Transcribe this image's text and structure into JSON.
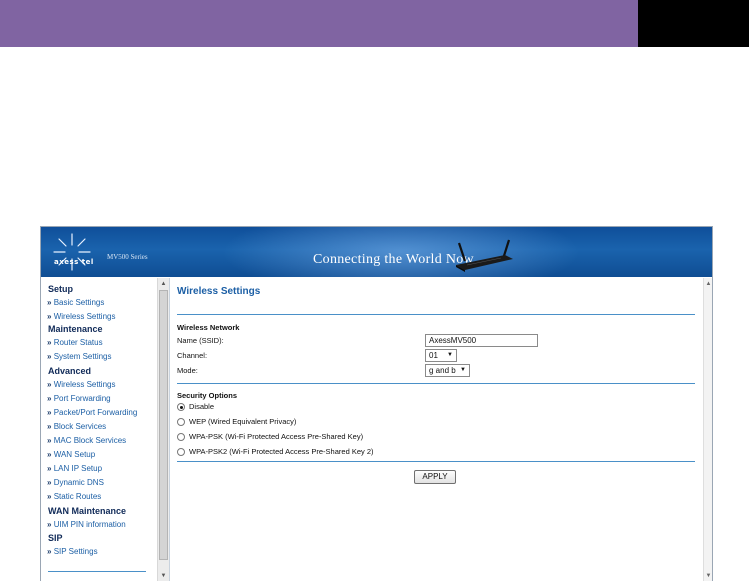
{
  "banner": {
    "logo_text": "axess tel",
    "series": "MV500 Series",
    "tagline": "Connecting the World Now"
  },
  "sidebar": {
    "arrow": "»",
    "sections": [
      {
        "heading": "Setup",
        "items": [
          "Basic Settings",
          "Wireless Settings"
        ]
      },
      {
        "heading": "Maintenance",
        "items": [
          "Router Status",
          "System Settings"
        ]
      },
      {
        "heading": "Advanced",
        "items": [
          "Wireless Settings",
          "Port Forwarding",
          "Packet/Port Forwarding",
          "Block Services",
          "MAC Block Services",
          "WAN Setup",
          "LAN IP Setup",
          "Dynamic DNS",
          "Static Routes"
        ]
      },
      {
        "heading": "WAN Maintenance",
        "items": [
          "UIM PIN information"
        ]
      },
      {
        "heading": "SIP",
        "items": [
          "SIP Settings"
        ]
      }
    ]
  },
  "main": {
    "title": "Wireless Settings",
    "wireless_network": {
      "heading": "Wireless Network",
      "ssid_label": "Name (SSID):",
      "ssid_value": "AxessMV500",
      "channel_label": "Channel:",
      "channel_value": "01",
      "mode_label": "Mode:",
      "mode_value": "g and b"
    },
    "security": {
      "heading": "Security Options",
      "options": [
        {
          "label": "Disable",
          "checked": true
        },
        {
          "label": "WEP (Wired Equivalent Privacy)",
          "checked": false
        },
        {
          "label": "WPA-PSK (Wi-Fi Protected Access Pre-Shared Key)",
          "checked": false
        },
        {
          "label": "WPA-PSK2 (Wi-Fi Protected Access Pre-Shared Key 2)",
          "checked": false
        }
      ]
    },
    "apply_label": "APPLY"
  },
  "colors": {
    "top_bar": "#8064a2",
    "banner": "#1a63ad",
    "link": "#1c5fa5",
    "heading": "#102a58"
  }
}
